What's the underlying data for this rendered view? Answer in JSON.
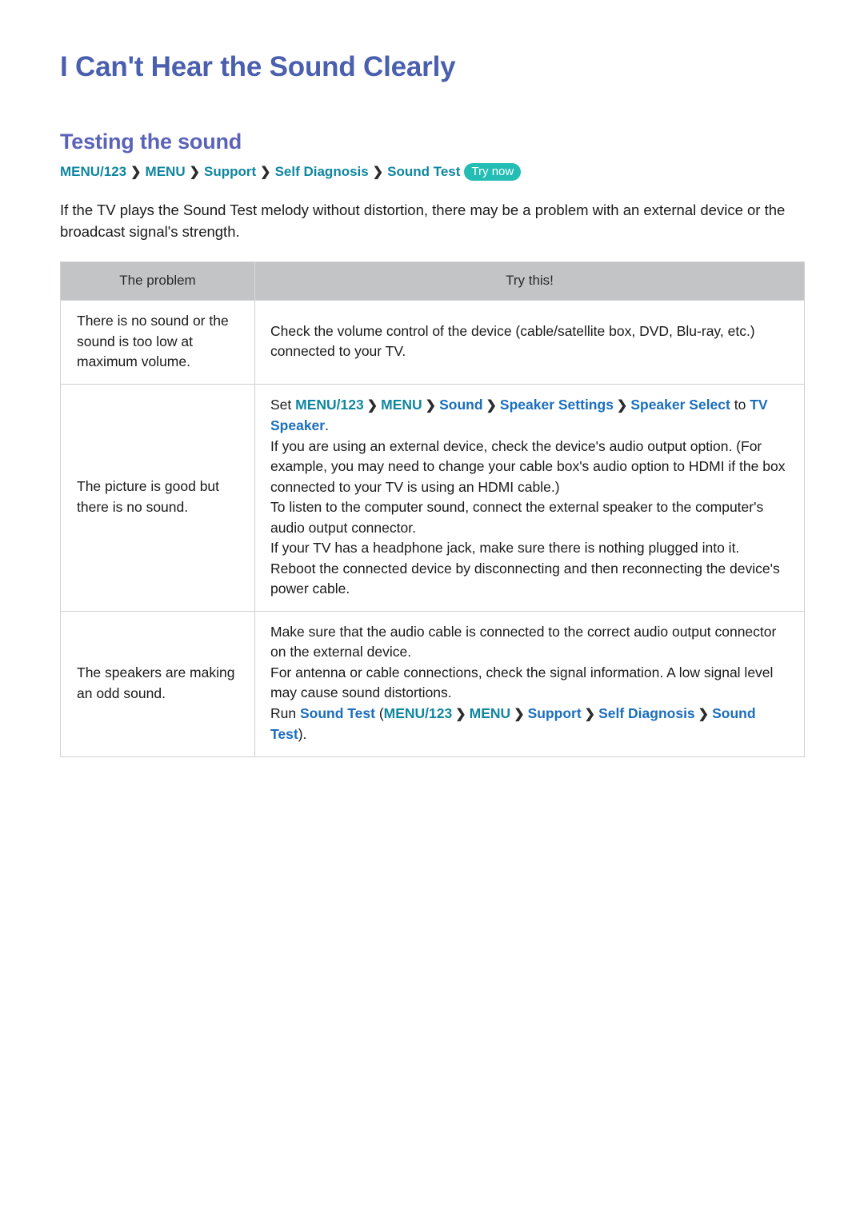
{
  "page": {
    "title": "I Can't Hear the Sound Clearly",
    "section_title": "Testing the sound",
    "intro": "If the TV plays the Sound Test melody without distortion, there may be a problem with an external device or the broadcast signal's strength."
  },
  "breadcrumb": {
    "separator": "❯",
    "items": [
      "MENU/123",
      "MENU",
      "Support",
      "Self Diagnosis",
      "Sound Test"
    ],
    "badge": "Try now"
  },
  "table": {
    "headers": [
      "The problem",
      "Try this!"
    ],
    "rows": [
      {
        "problem": "There is no sound or the sound is too low at maximum volume.",
        "fix_lines": [
          "Check the volume control of the device (cable/satellite box, DVD, Blu-ray, etc.) connected to your TV."
        ]
      },
      {
        "problem": "The picture is good but there is no sound.",
        "fix_lines": [
          "If you are using an external device, check the device's audio output option. (For example, you may need to change your cable box's audio option to HDMI if the box connected to your TV is using an HDMI cable.)",
          "To listen to the computer sound, connect the external speaker to the computer's audio output connector.",
          "If your TV has a headphone jack, make sure there is nothing plugged into it.",
          "Reboot the connected device by disconnecting and then reconnecting the device's power cable."
        ],
        "path_line": {
          "prefix": "Set ",
          "tokens": [
            {
              "text": "MENU/123",
              "style": "teal"
            },
            {
              "text": "❯",
              "style": "sep"
            },
            {
              "text": "MENU",
              "style": "teal"
            },
            {
              "text": "❯",
              "style": "sep"
            },
            {
              "text": "Sound",
              "style": "blue"
            },
            {
              "text": "❯",
              "style": "sep"
            },
            {
              "text": "Speaker Settings",
              "style": "blue"
            },
            {
              "text": "❯",
              "style": "sep"
            },
            {
              "text": "Speaker Select",
              "style": "blue"
            },
            {
              "text": " to ",
              "style": "plain"
            },
            {
              "text": "TV Speaker",
              "style": "blue"
            },
            {
              "text": ".",
              "style": "plain"
            }
          ]
        }
      },
      {
        "problem": "The speakers are making an odd sound.",
        "fix_lines": [
          "Make sure that the audio cable is connected to the correct audio output connector on the external device.",
          "For antenna or cable connections, check the signal information. A low signal level may cause sound distortions."
        ],
        "path_line": {
          "prefix": "Run ",
          "tokens": [
            {
              "text": "Sound Test",
              "style": "blue"
            },
            {
              "text": " (",
              "style": "plain"
            },
            {
              "text": "MENU/123",
              "style": "teal"
            },
            {
              "text": "❯",
              "style": "sep"
            },
            {
              "text": "MENU",
              "style": "teal"
            },
            {
              "text": "❯",
              "style": "sep"
            },
            {
              "text": "Support",
              "style": "blue"
            },
            {
              "text": "❯",
              "style": "sep"
            },
            {
              "text": "Self Diagnosis",
              "style": "blue"
            },
            {
              "text": "❯",
              "style": "sep"
            },
            {
              "text": "Sound Test",
              "style": "blue"
            },
            {
              "text": ").",
              "style": "plain"
            }
          ]
        }
      }
    ]
  },
  "colors": {
    "title_blue": "#4a5fae",
    "section_blue": "#5b63b8",
    "teal": "#0f86a0",
    "link_blue": "#1a6ebd",
    "badge_teal": "#23bdb4",
    "header_gray": "#c3c4c6",
    "border_gray": "#d2d2d2"
  }
}
